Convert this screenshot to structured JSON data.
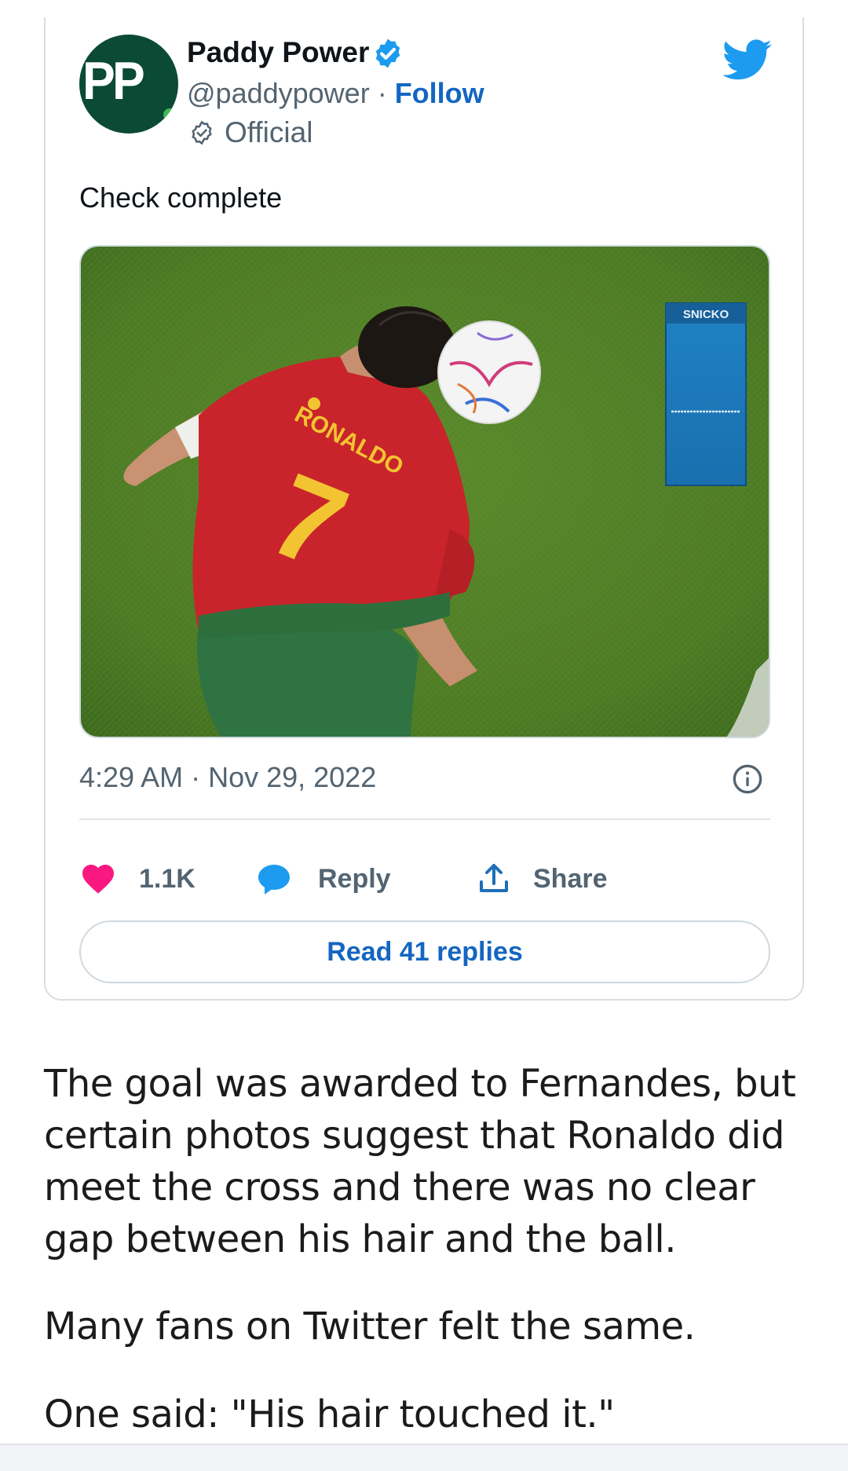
{
  "tweet": {
    "author_name": "Paddy Power",
    "avatar_text": "PP",
    "handle": "@paddypower",
    "separator": " · ",
    "follow_label": "Follow",
    "official_label": "Official",
    "text": "Check complete",
    "media": {
      "jersey_name": "RONALDO",
      "jersey_number": "7",
      "overlay_label": "SNICKO"
    },
    "timestamp": "4:29 AM · Nov 29, 2022",
    "likes_count": "1.1K",
    "reply_label": "Reply",
    "share_label": "Share",
    "read_replies_label": "Read 41 replies"
  },
  "article": {
    "paragraphs": [
      "The goal was awarded to Fernandes, but certain photos suggest that Ronaldo did meet the cross and there was no clear gap between his hair and the ball.",
      "Many fans on Twitter felt the same.",
      "One said: \"His hair touched it.\""
    ]
  },
  "icons": {
    "verified": "verified-badge-icon",
    "official": "official-check-icon",
    "twitter": "twitter-bird-icon",
    "like": "heart-icon",
    "reply": "reply-bubble-icon",
    "share": "share-icon",
    "info": "info-icon"
  },
  "colors": {
    "link_blue": "#1466c1",
    "twitter_blue": "#1d9bf0",
    "like_pink": "#f91880",
    "avatar_green": "#0b4a35",
    "text_gray": "#536471"
  }
}
